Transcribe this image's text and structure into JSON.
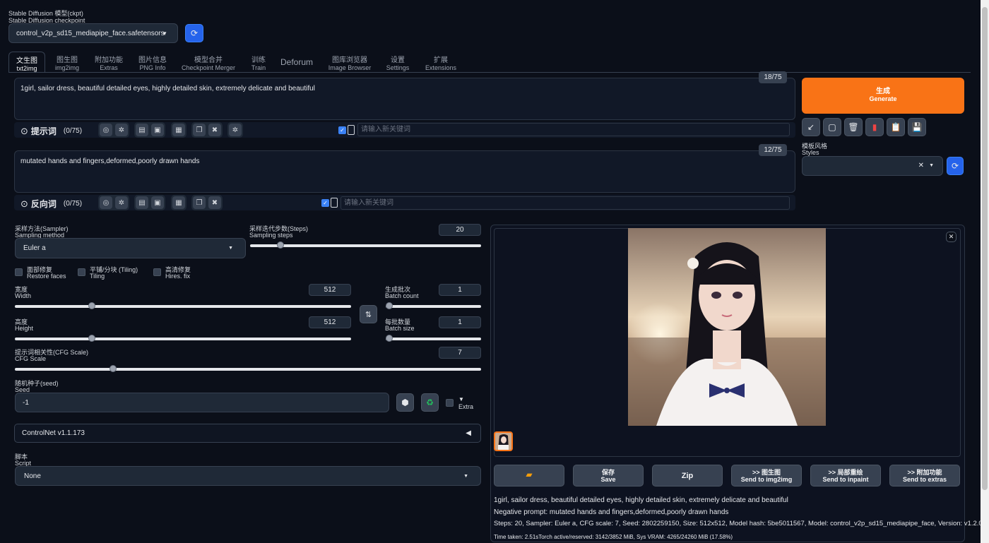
{
  "checkpoint": {
    "label_cn": "Stable Diffusion 模型(ckpt)",
    "label_en": "Stable Diffusion checkpoint",
    "value": "control_v2p_sd15_mediapipe_face.safetensors"
  },
  "tabs": [
    {
      "cn": "文生图",
      "en": "txt2img"
    },
    {
      "cn": "图生图",
      "en": "img2img"
    },
    {
      "cn": "附加功能",
      "en": "Extras"
    },
    {
      "cn": "图片信息",
      "en": "PNG Info"
    },
    {
      "cn": "模型合并",
      "en": "Checkpoint Merger"
    },
    {
      "cn": "训练",
      "en": "Train"
    },
    {
      "cn": "Deforum",
      "en": ""
    },
    {
      "cn": "图库浏览器",
      "en": "Image Browser"
    },
    {
      "cn": "设置",
      "en": "Settings"
    },
    {
      "cn": "扩展",
      "en": "Extensions"
    }
  ],
  "prompt": {
    "text": "1girl, sailor dress, beautiful detailed eyes, highly detailed skin, extremely delicate and beautiful",
    "token_count": "18/75",
    "section_label": "提示词",
    "section_count": "(0/75)",
    "keyword_placeholder": "请输入新关键词"
  },
  "negative": {
    "text": "mutated hands and fingers,deformed,poorly drawn hands",
    "token_count": "12/75",
    "section_label": "反向词",
    "section_count": "(0/75)",
    "keyword_placeholder": "请输入新关键词"
  },
  "generate": {
    "cn": "生成",
    "en": "Generate",
    "color": "#f97316"
  },
  "styles": {
    "cn": "模板风格",
    "en": "Styles"
  },
  "sampler": {
    "cn": "采样方法(Sampler)",
    "en": "Sampling method",
    "value": "Euler a"
  },
  "steps": {
    "cn": "采样迭代步数(Steps)",
    "en": "Sampling steps",
    "value": "20",
    "fraction": 0.13
  },
  "checkboxes": [
    {
      "cn": "面部修复",
      "en": "Restore faces"
    },
    {
      "cn": "平铺/分块 (Tiling)",
      "en": "Tiling"
    },
    {
      "cn": "高清修复",
      "en": "Hires. fix"
    }
  ],
  "width": {
    "cn": "宽度",
    "en": "Width",
    "value": "512",
    "fraction": 0.23
  },
  "height": {
    "cn": "高度",
    "en": "Height",
    "value": "512",
    "fraction": 0.23
  },
  "batch_count": {
    "cn": "生成批次",
    "en": "Batch count",
    "value": "1",
    "fraction": 0.0
  },
  "batch_size": {
    "cn": "每批数量",
    "en": "Batch size",
    "value": "1",
    "fraction": 0.0
  },
  "cfg": {
    "cn": "提示词相关性(CFG Scale)",
    "en": "CFG Scale",
    "value": "7",
    "fraction": 0.21
  },
  "seed": {
    "cn": "随机种子(seed)",
    "en": "Seed",
    "value": "-1",
    "extra": "Extra"
  },
  "controlnet": {
    "label": "ControlNet v1.1.173"
  },
  "script": {
    "cn": "脚本",
    "en": "Script",
    "value": "None"
  },
  "output_buttons": [
    {
      "cn": "",
      "en": "",
      "icon": "folder-icon"
    },
    {
      "cn": "保存",
      "en": "Save"
    },
    {
      "cn": "Zip",
      "en": ""
    },
    {
      "cn": ">> 图生图",
      "en": "Send to img2img"
    },
    {
      "cn": ">> 局部重绘",
      "en": "Send to inpaint"
    },
    {
      "cn": ">> 附加功能",
      "en": "Send to extras"
    }
  ],
  "output_info": {
    "prompt": "1girl, sailor dress, beautiful detailed eyes, highly detailed skin, extremely delicate and beautiful",
    "negative": "Negative prompt: mutated hands and fingers,deformed,poorly drawn hands",
    "params": "Steps: 20, Sampler: Euler a, CFG scale: 7, Seed: 2802259150, Size: 512x512, Model hash: 5be5011567, Model: control_v2p_sd15_mediapipe_face, Version: v1.2.0",
    "time": "Time taken: 2.51sTorch active/reserved: 3142/3852 MiB, Sys VRAM: 4265/24260 MiB (17.58%)"
  }
}
